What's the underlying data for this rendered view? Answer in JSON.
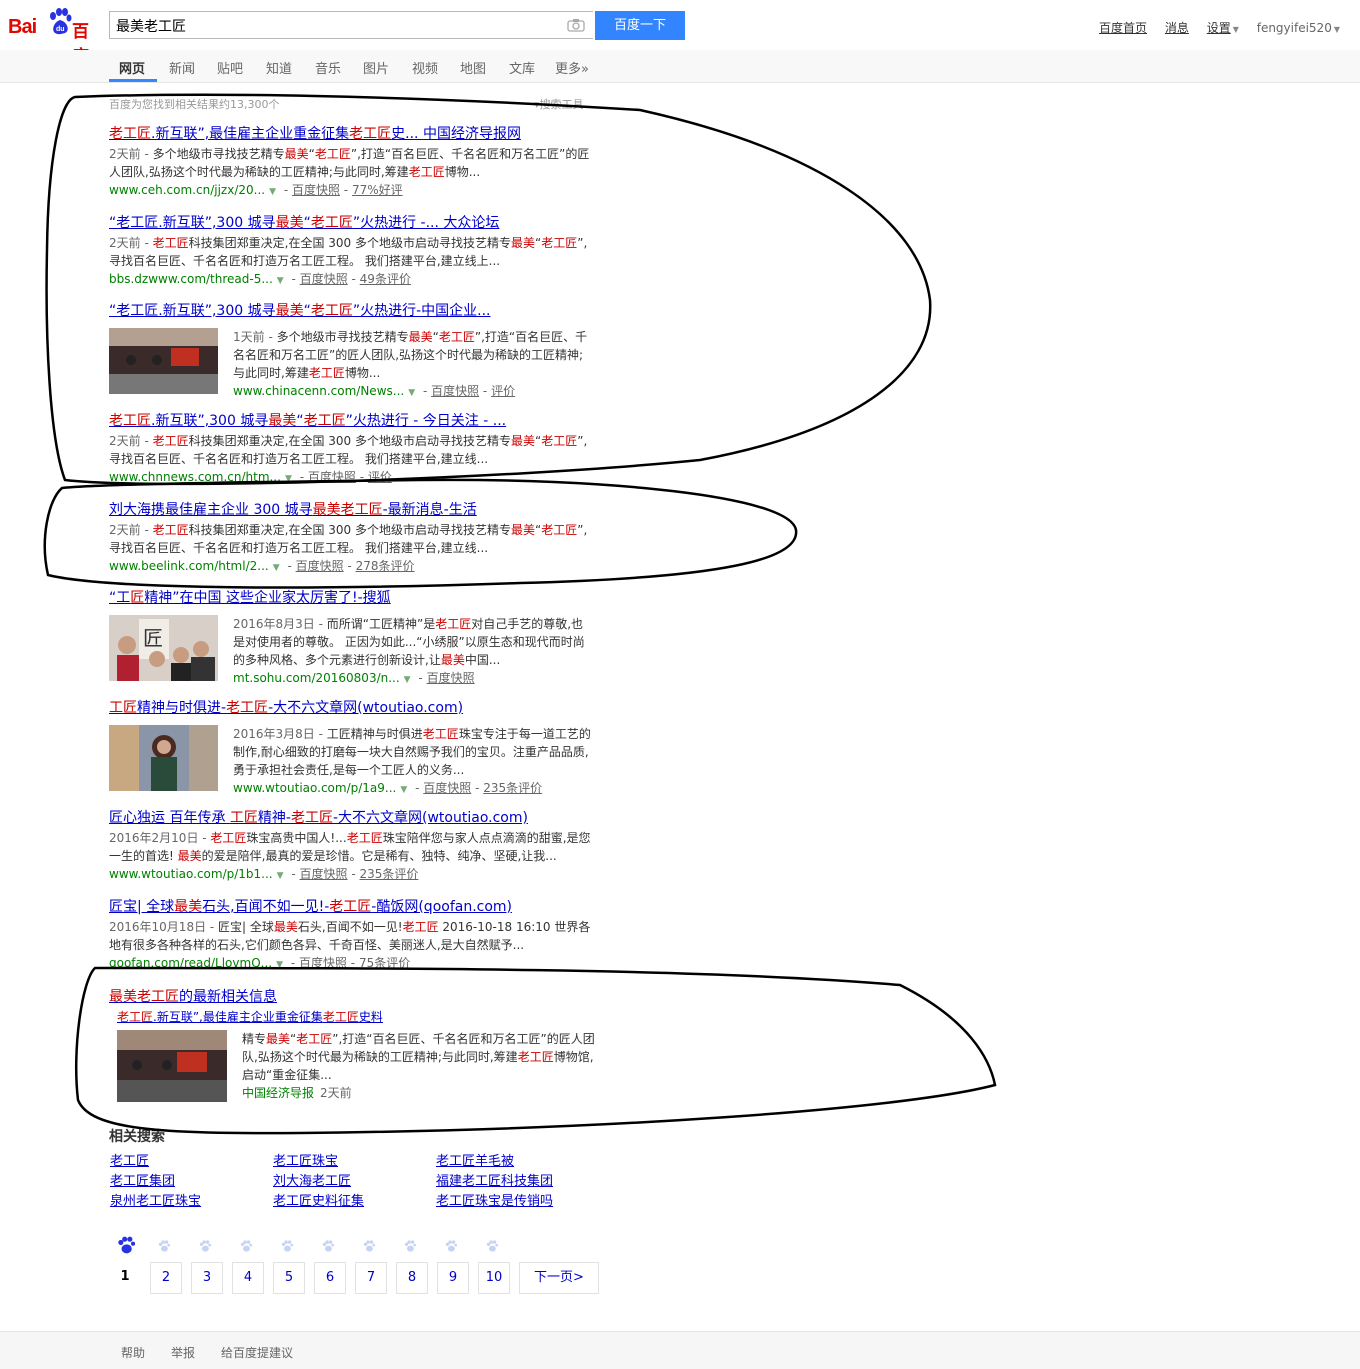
{
  "header": {
    "logo_text_left": "Bai",
    "logo_text_right": "百度",
    "search_value": "最美老工匠",
    "search_button": "百度一下",
    "user_links": [
      "百度首页",
      "消息",
      "设置",
      "fengyifei520"
    ]
  },
  "nav": {
    "tabs": [
      "网页",
      "新闻",
      "贴吧",
      "知道",
      "音乐",
      "图片",
      "视频",
      "地图",
      "文库",
      "更多»"
    ],
    "active": "网页"
  },
  "results_count": "百度为您找到相关结果约13,300个",
  "search_tools": "搜索工具",
  "results": [
    {
      "title_parts": [
        [
          "老工匠",
          true
        ],
        [
          ".新互联”,最佳雇主企业重金征集",
          false
        ],
        [
          "老工匠",
          true
        ],
        [
          "史... 中国经济导报网",
          false
        ]
      ],
      "date": "2天前 - ",
      "abs_parts": [
        [
          "多个地级市寻找技艺精专",
          false
        ],
        [
          "最美",
          true
        ],
        [
          "“",
          false
        ],
        [
          "老工匠",
          true
        ],
        [
          "”,打造“百名巨匠、千名名匠和万名工匠”的匠人团队,弘扬这个时代最为稀缺的工匠精神;与此同时,筹建",
          false
        ],
        [
          "老工匠",
          true
        ],
        [
          "博物...",
          false
        ]
      ],
      "url": "www.ceh.com.cn/jjzx/20...",
      "extras": [
        "百度快照",
        "77%好评"
      ]
    },
    {
      "title_parts": [
        [
          "“老工匠.新互联”,300 城寻",
          false
        ],
        [
          "最美",
          true
        ],
        [
          "“",
          false
        ],
        [
          "老工匠",
          true
        ],
        [
          "”火热进行 -... 大众论坛",
          false
        ]
      ],
      "date": "2天前 - ",
      "abs_parts": [
        [
          "老工匠",
          true
        ],
        [
          "科技集团郑重决定,在全国 300 多个地级市启动寻找技艺精专",
          false
        ],
        [
          "最美",
          true
        ],
        [
          "“",
          false
        ],
        [
          "老工匠",
          true
        ],
        [
          "”,寻找百名巨匠、千名名匠和打造万名工匠工程。 我们搭建平台,建立线上...",
          false
        ]
      ],
      "url": "bbs.dzwww.com/thread-5...",
      "extras": [
        "百度快照",
        "49条评价"
      ]
    },
    {
      "title_parts": [
        [
          "“老工匠.新互联”,300 城寻",
          false
        ],
        [
          "最美",
          true
        ],
        [
          "“",
          false
        ],
        [
          "老工匠",
          true
        ],
        [
          "”火热进行-中国企业...",
          false
        ]
      ],
      "date": "1天前 - ",
      "abs_parts": [
        [
          "多个地级市寻找技艺精专",
          false
        ],
        [
          "最美",
          true
        ],
        [
          "“",
          false
        ],
        [
          "老工匠",
          true
        ],
        [
          "”,打造“百名巨匠、千名名匠和万名工匠”的匠人团队,弘扬这个时代最为稀缺的工匠精神;与此同时,筹建",
          false
        ],
        [
          "老工匠",
          true
        ],
        [
          "博物...",
          false
        ]
      ],
      "url": "www.chinacenn.com/News...",
      "extras": [
        "百度快照",
        "评价"
      ]
    },
    {
      "title_parts": [
        [
          "老工匠",
          true
        ],
        [
          ".新互联”,300 城寻",
          false
        ],
        [
          "最美",
          true
        ],
        [
          "“",
          false
        ],
        [
          "老工匠",
          true
        ],
        [
          "”火热进行 - 今日关注 - ...",
          false
        ]
      ],
      "date": "2天前 - ",
      "abs_parts": [
        [
          "老工匠",
          true
        ],
        [
          "科技集团郑重决定,在全国 300 多个地级市启动寻找技艺精专",
          false
        ],
        [
          "最美",
          true
        ],
        [
          "“",
          false
        ],
        [
          "老工匠",
          true
        ],
        [
          "”,寻找百名巨匠、千名名匠和打造万名工匠工程。 我们搭建平台,建立线...",
          false
        ]
      ],
      "url": "www.chnnews.com.cn/htm...",
      "extras": [
        "百度快照",
        "评价"
      ]
    },
    {
      "title_parts": [
        [
          "刘大海携最佳雇主企业 300 城寻",
          false
        ],
        [
          "最美老工匠",
          true
        ],
        [
          "-最新消息-生活",
          false
        ]
      ],
      "date": "2天前 - ",
      "abs_parts": [
        [
          "老工匠",
          true
        ],
        [
          "科技集团郑重决定,在全国 300 多个地级市启动寻找技艺精专",
          false
        ],
        [
          "最美",
          true
        ],
        [
          "“",
          false
        ],
        [
          "老工匠",
          true
        ],
        [
          "”,寻找百名巨匠、千名名匠和打造万名工匠工程。 我们搭建平台,建立线...",
          false
        ]
      ],
      "url": "www.beelink.com/html/2...",
      "extras": [
        "百度快照",
        "278条评价"
      ]
    },
    {
      "title_parts": [
        [
          "“工",
          false
        ],
        [
          "匠",
          true
        ],
        [
          "精神”在中国 这些企业家太厉害了!-搜狐",
          false
        ]
      ],
      "date": "2016年8月3日 - ",
      "abs_parts": [
        [
          "而所谓“工匠精神”是",
          false
        ],
        [
          "老工匠",
          true
        ],
        [
          "对自己手艺的尊敬,也是对使用者的尊敬。 正因为如此...“小绣服”以原生态和现代而时尚的多种风格、多个元素进行创新设计,让",
          false
        ],
        [
          "最美",
          true
        ],
        [
          "中国...",
          false
        ]
      ],
      "url": "mt.sohu.com/20160803/n...",
      "extras": [
        "百度快照"
      ]
    },
    {
      "title_parts": [
        [
          "工匠",
          true
        ],
        [
          "精神与时俱进-",
          false
        ],
        [
          "老工匠",
          true
        ],
        [
          "-大不六文章网(wtoutiao.com)",
          false
        ]
      ],
      "date": "2016年3月8日 - ",
      "abs_parts": [
        [
          "工匠精神与时俱进",
          false
        ],
        [
          "老工匠",
          true
        ],
        [
          "珠宝专注于每一道工艺的制作,耐心细致的打磨每一块大自然赐予我们的宝贝。注重产品品质,勇于承担社会责任,是每一个工匠人的义务...",
          false
        ]
      ],
      "url": "www.wtoutiao.com/p/1a9...",
      "extras": [
        "百度快照",
        "235条评价"
      ]
    },
    {
      "title_parts": [
        [
          "匠心独运 百年传承 ",
          false
        ],
        [
          "工匠",
          true
        ],
        [
          "精神-",
          false
        ],
        [
          "老工匠",
          true
        ],
        [
          "-大不六文章网(wtoutiao.com)",
          false
        ]
      ],
      "date": "2016年2月10日 - ",
      "abs_parts": [
        [
          "老工匠",
          true
        ],
        [
          "珠宝高贵中国人!...",
          false
        ],
        [
          "老工匠",
          true
        ],
        [
          "珠宝陪伴您与家人点点滴滴的甜蜜,是您一生的首选! ",
          false
        ],
        [
          "最美",
          true
        ],
        [
          "的爱是陪伴,最真的爱是珍惜。它是稀有、独特、纯净、坚硬,让我...",
          false
        ]
      ],
      "url": "www.wtoutiao.com/p/1b1...",
      "extras": [
        "百度快照",
        "235条评价"
      ]
    },
    {
      "title_parts": [
        [
          "匠宝| 全球",
          false
        ],
        [
          "最美",
          true
        ],
        [
          "石头,百闻不如一见!-",
          false
        ],
        [
          "老工匠",
          true
        ],
        [
          "-酷饭网(qoofan.com)",
          false
        ]
      ],
      "date": "2016年10月18日 - ",
      "abs_parts": [
        [
          "匠宝| 全球",
          false
        ],
        [
          "最美",
          true
        ],
        [
          "石头,百闻不如一见!",
          false
        ],
        [
          "老工匠",
          true
        ],
        [
          " 2016-10-18 16:10 世界各地有很多各种各样的石头,它们颜色各异、千奇百怪、美丽迷人,是大自然赋予...",
          false
        ]
      ],
      "url": "qoofan.com/read/LlovmQ...",
      "extras": [
        "百度快照",
        "75条评价"
      ]
    }
  ],
  "news": {
    "title_hl": "最美老工匠",
    "title_rest": "的最新相关信息",
    "sub_parts": [
      [
        "老工匠",
        true
      ],
      [
        ".新互联”,最佳雇主企业重金征集",
        false
      ],
      [
        "老工匠",
        true
      ],
      [
        "史料",
        false
      ]
    ],
    "abs_parts": [
      [
        "精专",
        false
      ],
      [
        "最美",
        true
      ],
      [
        "“",
        false
      ],
      [
        "老工匠",
        true
      ],
      [
        "”,打造“百名巨匠、千名名匠和万名工匠”的匠人团队,弘扬这个时代最为稀缺的工匠精神;与此同时,筹建",
        false
      ],
      [
        "老工匠",
        true
      ],
      [
        "博物馆,启动“重金征集...",
        false
      ]
    ],
    "source": "中国经济导报",
    "time": "2天前"
  },
  "related": {
    "title": "相关搜索",
    "items": [
      "老工匠",
      "老工匠珠宝",
      "老工匠羊毛被",
      "老工匠集团",
      "刘大海老工匠",
      "福建老工匠科技集团",
      "泉州老工匠珠宝",
      "老工匠史料征集",
      "老工匠珠宝是传销吗"
    ]
  },
  "pager": {
    "pages": [
      "1",
      "2",
      "3",
      "4",
      "5",
      "6",
      "7",
      "8",
      "9",
      "10"
    ],
    "next": "下一页>"
  },
  "footer": [
    "帮助",
    "举报",
    "给百度提建议"
  ],
  "colors": {
    "link": "#0000cc",
    "highlight": "#cc0000",
    "url": "#008000",
    "button": "#3385ff"
  }
}
